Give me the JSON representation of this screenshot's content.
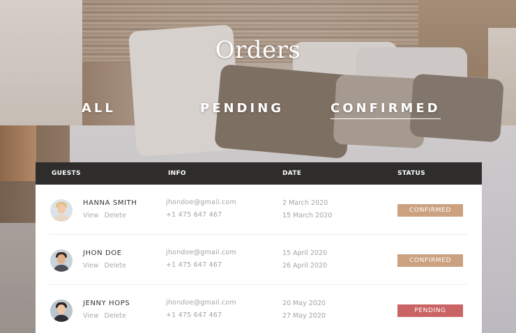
{
  "header": {
    "title": "Orders"
  },
  "tabs": [
    {
      "label": "ALL",
      "active": false
    },
    {
      "label": "PENDING",
      "active": false
    },
    {
      "label": "CONFIRMED",
      "active": true
    }
  ],
  "table": {
    "columns": [
      "GUESTS",
      "INFO",
      "DATE",
      "STATUS"
    ],
    "rows": [
      {
        "name": "HANNA SMITH",
        "view": "View",
        "delete": "Delete",
        "email": "jhondoe@gmail.com",
        "phone": "+1 475 647 467",
        "date_from": "2 March 2020",
        "date_to": "15 March 2020",
        "status": "CONFIRMED",
        "status_color": "#cba180"
      },
      {
        "name": "JHON DOE",
        "view": "View",
        "delete": "Delete",
        "email": "jhondoe@gmail.com",
        "phone": "+1 475 647 467",
        "date_from": "15 April 2020",
        "date_to": "26 April 2020",
        "status": "CONFIRMED",
        "status_color": "#cba180"
      },
      {
        "name": "JENNY HOPS",
        "view": "View",
        "delete": "Delete",
        "email": "jhondoe@gmail.com",
        "phone": "+1 475 647 467",
        "date_from": "20 May 2020",
        "date_to": "27 May 2020",
        "status": "PENDING",
        "status_color": "#c96364"
      }
    ]
  },
  "colors": {
    "header_bg": "#2e2d2c",
    "confirmed": "#cba180",
    "pending": "#c96364"
  }
}
